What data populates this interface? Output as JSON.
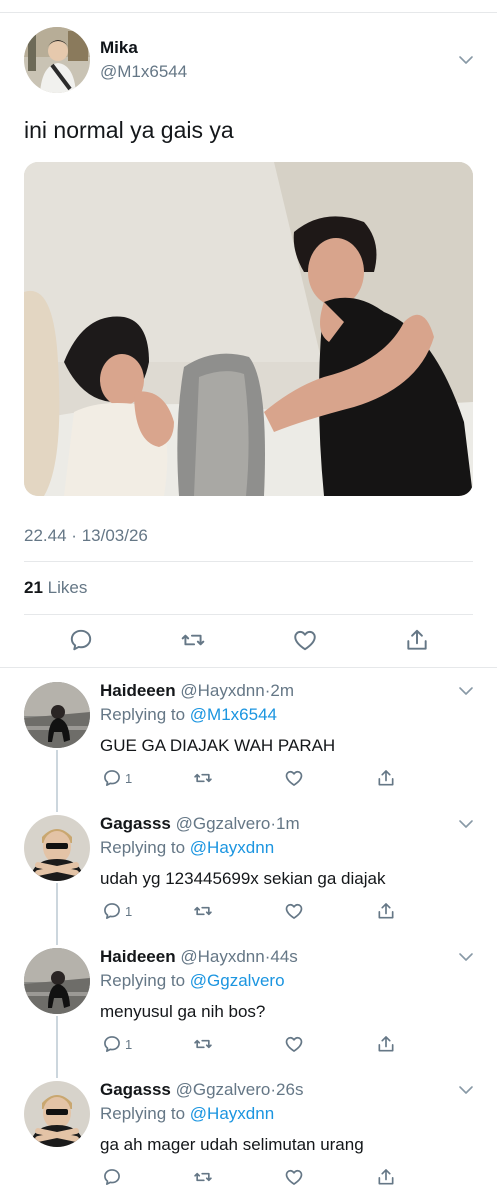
{
  "tweet": {
    "author": {
      "name": "Mika",
      "handle": "@M1x6544"
    },
    "text": "ini normal ya gais ya",
    "time": "22.44",
    "separator": "·",
    "date": "13/03/26",
    "likes_count": "21",
    "likes_label": "Likes"
  },
  "replies": [
    {
      "name": "Haideeen",
      "handle": "@Hayxdnn",
      "time": "2m",
      "replying_label": "Replying to",
      "replying_to": "@M1x6544",
      "text": "GUE GA DIAJAK WAH PARAH",
      "reply_count": "1"
    },
    {
      "name": "Gagasss",
      "handle": "@Ggzalvero",
      "time": "1m",
      "replying_label": "Replying to",
      "replying_to": "@Hayxdnn",
      "text": "udah yg 123445699x sekian ga diajak",
      "reply_count": "1"
    },
    {
      "name": "Haideeen",
      "handle": "@Hayxdnn",
      "time": "44s",
      "replying_label": "Replying to",
      "replying_to": "@Ggzalvero",
      "text": "menyusul ga nih bos?",
      "reply_count": "1"
    },
    {
      "name": "Gagasss",
      "handle": "@Ggzalvero",
      "time": "26s",
      "replying_label": "Replying to",
      "replying_to": "@Hayxdnn",
      "text": "ga ah mager udah selimutan urang",
      "reply_count": ""
    }
  ],
  "icons": {
    "reply": "reply-icon",
    "retweet": "retweet-icon",
    "like": "heart-icon",
    "share": "share-icon",
    "more": "chevron-down-icon"
  },
  "colors": {
    "text": "#14171a",
    "secondary": "#657786",
    "link": "#1b95e0",
    "divider": "#e6e8ea",
    "thread": "#ccd6dd"
  }
}
